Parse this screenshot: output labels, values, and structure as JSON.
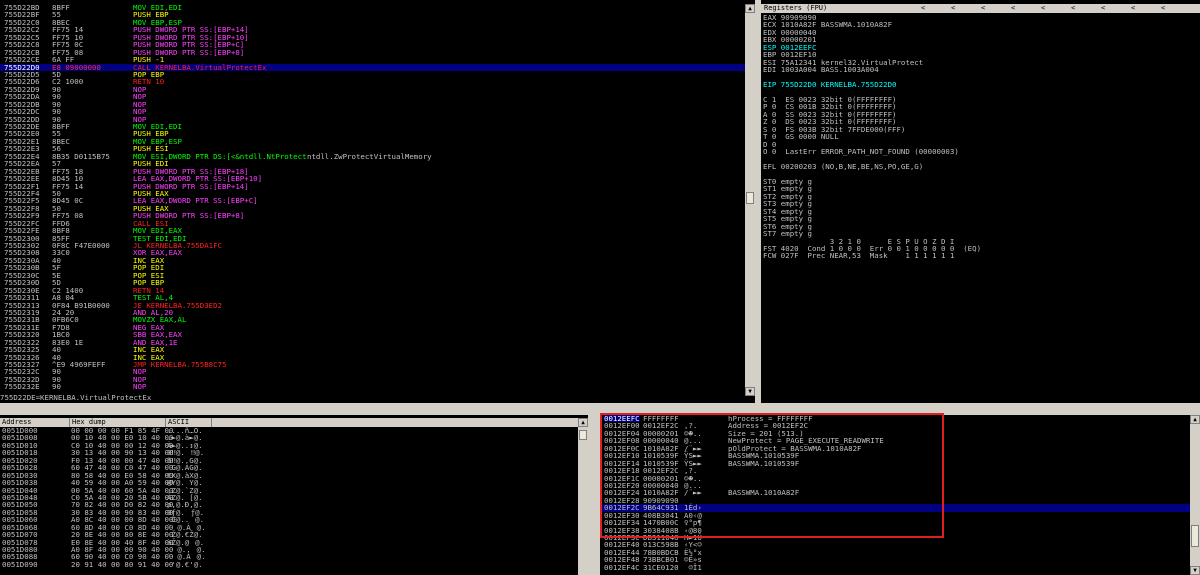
{
  "colors": {
    "mnem_green": "#00ff00",
    "mnem_yellow": "#ffff00",
    "mnem_magenta": "#ff40ff",
    "mnem_red": "#ff2020",
    "mnem_cyan": "#00ffff",
    "mnem_white": "#ffffff",
    "mnem_blue": "#8080ff",
    "selection_bg": "#000080",
    "highlight_box": "#e02020"
  },
  "disasm": [
    {
      "addr": "755D22BD",
      "hex": "8BFF",
      "mnem": "MOV EDI,EDI",
      "c": "mnem_green"
    },
    {
      "addr": "755D22BF",
      "hex": "55",
      "mnem": "PUSH EBP",
      "c": "mnem_yellow"
    },
    {
      "addr": "755D22C0",
      "hex": "8BEC",
      "mnem": "MOV EBP,ESP",
      "c": "mnem_green"
    },
    {
      "addr": "755D22C2",
      "hex": "FF75 14",
      "mnem": "PUSH DWORD PTR SS:[EBP+14]",
      "c": "mnem_magenta"
    },
    {
      "addr": "755D22C5",
      "hex": "FF75 10",
      "mnem": "PUSH DWORD PTR SS:[EBP+10]",
      "c": "mnem_magenta"
    },
    {
      "addr": "755D22C8",
      "hex": "FF75 0C",
      "mnem": "PUSH DWORD PTR SS:[EBP+C]",
      "c": "mnem_magenta"
    },
    {
      "addr": "755D22CB",
      "hex": "FF75 08",
      "mnem": "PUSH DWORD PTR SS:[EBP+8]",
      "c": "mnem_magenta"
    },
    {
      "addr": "755D22CE",
      "hex": "6A FF",
      "mnem": "PUSH -1",
      "c": "mnem_yellow"
    },
    {
      "addr": "755D22D0",
      "hex": "E8 09000000",
      "mnem": "CALL KERNELBA.VirtualProtectEx",
      "c": "mnem_red",
      "sel": true
    },
    {
      "addr": "755D22D5",
      "hex": "5D",
      "mnem": "POP EBP",
      "c": "mnem_yellow"
    },
    {
      "addr": "755D22D6",
      "hex": "C2 1000",
      "mnem": "RETN 10",
      "c": "mnem_red"
    },
    {
      "addr": "755D22D9",
      "hex": "90",
      "mnem": "NOP",
      "c": "mnem_magenta"
    },
    {
      "addr": "755D22DA",
      "hex": "90",
      "mnem": "NOP",
      "c": "mnem_magenta"
    },
    {
      "addr": "755D22DB",
      "hex": "90",
      "mnem": "NOP",
      "c": "mnem_magenta"
    },
    {
      "addr": "755D22DC",
      "hex": "90",
      "mnem": "NOP",
      "c": "mnem_magenta"
    },
    {
      "addr": "755D22DD",
      "hex": "90",
      "mnem": "NOP",
      "c": "mnem_magenta"
    },
    {
      "addr": "755D22DE",
      "hex": "8BFF",
      "mnem": "MOV EDI,EDI",
      "c": "mnem_green"
    },
    {
      "addr": "755D22E0",
      "hex": "55",
      "mnem": "PUSH EBP",
      "c": "mnem_yellow"
    },
    {
      "addr": "755D22E1",
      "hex": "8BEC",
      "mnem": "MOV EBP,ESP",
      "c": "mnem_green"
    },
    {
      "addr": "755D22E3",
      "hex": "56",
      "mnem": "PUSH ESI",
      "c": "mnem_yellow"
    },
    {
      "addr": "755D22E4",
      "hex": "8B35 D0115B75",
      "mnem": "MOV ESI,DWORD PTR DS:[<&ntdll.NtProtect",
      "c": "mnem_green",
      "extra": "ntdll.ZwProtectVirtualMemory"
    },
    {
      "addr": "755D22EA",
      "hex": "57",
      "mnem": "PUSH EDI",
      "c": "mnem_yellow"
    },
    {
      "addr": "755D22EB",
      "hex": "FF75 18",
      "mnem": "PUSH DWORD PTR SS:[EBP+18]",
      "c": "mnem_magenta"
    },
    {
      "addr": "755D22EE",
      "hex": "8D45 10",
      "mnem": "LEA EAX,DWORD PTR SS:[EBP+10]",
      "c": "mnem_magenta"
    },
    {
      "addr": "755D22F1",
      "hex": "FF75 14",
      "mnem": "PUSH DWORD PTR SS:[EBP+14]",
      "c": "mnem_magenta"
    },
    {
      "addr": "755D22F4",
      "hex": "50",
      "mnem": "PUSH EAX",
      "c": "mnem_yellow"
    },
    {
      "addr": "755D22F5",
      "hex": "8D45 0C",
      "mnem": "LEA EAX,DWORD PTR SS:[EBP+C]",
      "c": "mnem_magenta"
    },
    {
      "addr": "755D22F8",
      "hex": "50",
      "mnem": "PUSH EAX",
      "c": "mnem_yellow"
    },
    {
      "addr": "755D22F9",
      "hex": "FF75 08",
      "mnem": "PUSH DWORD PTR SS:[EBP+8]",
      "c": "mnem_magenta"
    },
    {
      "addr": "755D22FC",
      "hex": "FFD6",
      "mnem": "CALL ESI",
      "c": "mnem_red"
    },
    {
      "addr": "755D22FE",
      "hex": "8BF8",
      "mnem": "MOV EDI,EAX",
      "c": "mnem_green"
    },
    {
      "addr": "755D2300",
      "hex": "85FF",
      "mnem": "TEST EDI,EDI",
      "c": "mnem_green"
    },
    {
      "addr": "755D2302",
      "hex": "0F8C F47E0000",
      "mnem": "JL KERNELBA.755DA1FC",
      "c": "mnem_red"
    },
    {
      "addr": "755D2308",
      "hex": "33C0",
      "mnem": "XOR EAX,EAX",
      "c": "mnem_magenta"
    },
    {
      "addr": "755D230A",
      "hex": "40",
      "mnem": "INC EAX",
      "c": "mnem_yellow"
    },
    {
      "addr": "755D230B",
      "hex": "5F",
      "mnem": "POP EDI",
      "c": "mnem_yellow"
    },
    {
      "addr": "755D230C",
      "hex": "5E",
      "mnem": "POP ESI",
      "c": "mnem_yellow"
    },
    {
      "addr": "755D230D",
      "hex": "5D",
      "mnem": "POP EBP",
      "c": "mnem_yellow"
    },
    {
      "addr": "755D230E",
      "hex": "C2 1400",
      "mnem": "RETN 14",
      "c": "mnem_red"
    },
    {
      "addr": "755D2311",
      "hex": "A8 04",
      "mnem": "TEST AL,4",
      "c": "mnem_green"
    },
    {
      "addr": "755D2313",
      "hex": "0F84 B91B0000",
      "mnem": "JE KERNELBA.755D3ED2",
      "c": "mnem_red"
    },
    {
      "addr": "755D2319",
      "hex": "24 20",
      "mnem": "AND AL,20",
      "c": "mnem_magenta"
    },
    {
      "addr": "755D231B",
      "hex": "0FB6C0",
      "mnem": "MOVZX EAX,AL",
      "c": "mnem_green"
    },
    {
      "addr": "755D231E",
      "hex": "F7D8",
      "mnem": "NEG EAX",
      "c": "mnem_magenta"
    },
    {
      "addr": "755D2320",
      "hex": "1BC0",
      "mnem": "SBB EAX,EAX",
      "c": "mnem_magenta"
    },
    {
      "addr": "755D2322",
      "hex": "83E0 1E",
      "mnem": "AND EAX,1E",
      "c": "mnem_magenta"
    },
    {
      "addr": "755D2325",
      "hex": "40",
      "mnem": "INC EAX",
      "c": "mnem_yellow"
    },
    {
      "addr": "755D2326",
      "hex": "40",
      "mnem": "INC EAX",
      "c": "mnem_yellow"
    },
    {
      "addr": "755D2327",
      "hex": "^E9 4969FEFF",
      "mnem": "JMP KERNELBA.755B8C75",
      "c": "mnem_red"
    },
    {
      "addr": "755D232C",
      "hex": "90",
      "mnem": "NOP",
      "c": "mnem_magenta"
    },
    {
      "addr": "755D232D",
      "hex": "90",
      "mnem": "NOP",
      "c": "mnem_magenta"
    },
    {
      "addr": "755D232E",
      "hex": "90",
      "mnem": "NOP",
      "c": "mnem_magenta"
    }
  ],
  "info_line": "755D22DE=KERNELBA.VirtualProtectEx",
  "registers": {
    "title": "Registers (FPU)",
    "chevrons": [
      "<",
      "<",
      "<",
      "<",
      "<",
      "<",
      "<",
      "<",
      "<"
    ],
    "lines": [
      {
        "t": "EAX 90909090"
      },
      {
        "t": "ECX 1010A82F BASSWMA.1010A82F"
      },
      {
        "t": "EDX 00000040"
      },
      {
        "t": "EBX 00000201"
      },
      {
        "t": "ESP 0012EEFC",
        "hl": true
      },
      {
        "t": "EBP 0012EF10"
      },
      {
        "t": "ESI 75A12341 kernel32.VirtualProtect"
      },
      {
        "t": "EDI 1003A004 BASS.1003A004"
      },
      {
        "t": ""
      },
      {
        "t": "EIP 755D22D0 KERNELBA.755D22D0",
        "hl": true
      },
      {
        "t": ""
      },
      {
        "t": "C 1  ES 0023 32bit 0(FFFFFFFF)"
      },
      {
        "t": "P 0  CS 001B 32bit 0(FFFFFFFF)"
      },
      {
        "t": "A 0  SS 0023 32bit 0(FFFFFFFF)"
      },
      {
        "t": "Z 0  DS 0023 32bit 0(FFFFFFFF)"
      },
      {
        "t": "S 0  FS 003B 32bit 7FFDE000(FFF)"
      },
      {
        "t": "T 0  GS 0000 NULL"
      },
      {
        "t": "D 0"
      },
      {
        "t": "O 0  LastErr ERROR_PATH_NOT_FOUND (00000003)"
      },
      {
        "t": ""
      },
      {
        "t": "EFL 00200203 (NO,B,NE,BE,NS,PO,GE,G)"
      },
      {
        "t": ""
      },
      {
        "t": "ST0 empty g"
      },
      {
        "t": "ST1 empty g"
      },
      {
        "t": "ST2 empty g"
      },
      {
        "t": "ST3 empty g"
      },
      {
        "t": "ST4 empty g"
      },
      {
        "t": "ST5 empty g"
      },
      {
        "t": "ST6 empty g"
      },
      {
        "t": "ST7 empty g"
      },
      {
        "t": "               3 2 1 0      E S P U O Z D I"
      },
      {
        "t": "FST 4020  Cond 1 0 0 0  Err 0 0 1 0 0 0 0 0  (EQ)"
      },
      {
        "t": "FCW 027F  Prec NEAR,53  Mask    1 1 1 1 1 1"
      }
    ]
  },
  "dump": {
    "headers": [
      "Address",
      "Hex dump",
      "ASCII"
    ],
    "rows": [
      {
        "addr": "0051D000",
        "hex": "00 00 00 00 F1 85 4F 00",
        "ascii": "....ñ…O."
      },
      {
        "addr": "0051D008",
        "hex": "00 10 40 00 E0 10 40 00",
        "ascii": ".►@.à►@."
      },
      {
        "addr": "0051D010",
        "hex": "C0 10 40 00 00 12 40 00",
        "ascii": "À►@..↕@."
      },
      {
        "addr": "0051D018",
        "hex": "30 13 40 00 90 13 40 00",
        "ascii": "0‼@.‼@."
      },
      {
        "addr": "0051D020",
        "hex": "F0 13 40 00 00 47 40 00",
        "ascii": "ð‼@..G@."
      },
      {
        "addr": "0051D028",
        "hex": "60 47 40 00 C0 47 40 00",
        "ascii": "`G@.ÀG@."
      },
      {
        "addr": "0051D030",
        "hex": "80 58 40 00 E0 58 40 00",
        "ascii": "€X@.àX@."
      },
      {
        "addr": "0051D038",
        "hex": "40 59 40 00 A0 59 40 00",
        "ascii": "@Y@. Y@."
      },
      {
        "addr": "0051D040",
        "hex": "00 5A 40 00 60 5A 40 00",
        "ascii": ".Z@.`Z@."
      },
      {
        "addr": "0051D048",
        "hex": "C0 5A 40 00 20 5B 40 00",
        "ascii": "ÀZ@. [@."
      },
      {
        "addr": "0051D050",
        "hex": "70 82 40 00 D0 82 40 00",
        "ascii": "p‚@.Ð‚@."
      },
      {
        "addr": "0051D058",
        "hex": "30 83 40 00 90 83 40 00",
        "ascii": "0ƒ@.ƒ@."
      },
      {
        "addr": "0051D060",
        "hex": "A0 8C 40 00 00 8D 40 00",
        "ascii": " Œ@..@."
      },
      {
        "addr": "0051D068",
        "hex": "60 8D 40 00 C0 8D 40 00",
        "ascii": "`@.À@."
      },
      {
        "addr": "0051D070",
        "hex": "20 8E 40 00 80 8E 40 00",
        "ascii": " Ž@.€Ž@."
      },
      {
        "addr": "0051D078",
        "hex": "E0 8E 40 00 40 8F 40 00",
        "ascii": "àŽ@.@@."
      },
      {
        "addr": "0051D080",
        "hex": "A0 8F 40 00 00 90 40 00",
        "ascii": " @..@."
      },
      {
        "addr": "0051D088",
        "hex": "60 90 40 00 C0 90 40 00",
        "ascii": "`@.À@."
      },
      {
        "addr": "0051D090",
        "hex": "20 91 40 00 80 91 40 00",
        "ascii": " '@.€'@."
      }
    ]
  },
  "stack": {
    "rows": [
      {
        "addr": "0012EEFC",
        "val": "FFFFFFFF",
        "asc": "",
        "cmt": "hProcess = FFFFFFFF",
        "sel": true,
        "addrhl": true
      },
      {
        "addr": "0012EF00",
        "val": "0012EF2C",
        "asc": ",?.",
        "cmt": "Address = 0012EF2C"
      },
      {
        "addr": "0012EF04",
        "val": "00000201",
        "asc": "☺☻..",
        "cmt": "Size = 201 (513.)"
      },
      {
        "addr": "0012EF08",
        "val": "00000040",
        "asc": "@...",
        "cmt": "NewProtect = PAGE_EXECUTE_READWRITE"
      },
      {
        "addr": "0012EF0C",
        "val": "1010A82F",
        "asc": "/¨►►",
        "cmt": "pOldProtect = BASSWMA.1010A82F"
      },
      {
        "addr": "0012EF10",
        "val": "1010539F",
        "asc": "ŸS►►",
        "cmt": "BASSWMA.1010539F"
      },
      {
        "addr": "0012EF14",
        "val": "1010539F",
        "asc": "ŸS►►",
        "cmt": "BASSWMA.1010539F"
      },
      {
        "addr": "0012EF18",
        "val": "0012EF2C",
        "asc": ",?.",
        "cmt": ""
      },
      {
        "addr": "0012EF1C",
        "val": "00000201",
        "asc": "☺☻..",
        "cmt": ""
      },
      {
        "addr": "0012EF20",
        "val": "00000040",
        "asc": "@...",
        "cmt": ""
      },
      {
        "addr": "0012EF24",
        "val": "1010A82F",
        "asc": "/¨►►",
        "cmt": "BASSWMA.1010A82F"
      },
      {
        "addr": "0012EF28",
        "val": "90909090",
        "asc": "",
        "cmt": ""
      },
      {
        "addr": "0012EF2C",
        "val": "9B64C931",
        "asc": "1Éd›",
        "cmt": "",
        "hl": true
      },
      {
        "addr": "0012EF30",
        "val": "408B3041",
        "asc": "A0‹@",
        "cmt": ""
      },
      {
        "addr": "0012EF34",
        "val": "1470B00C",
        "asc": "♀°p¶",
        "cmt": ""
      },
      {
        "addr": "0012EF38",
        "val": "3038408B",
        "asc": "‹@80",
        "cmt": ""
      },
      {
        "addr": "0012EF3C",
        "val": "DB311048",
        "asc": "H►1Û",
        "cmt": ""
      },
      {
        "addr": "0012EF40",
        "val": "013C598B",
        "asc": "‹Y<☺",
        "cmt": ""
      },
      {
        "addr": "0012EF44",
        "val": "78B0BDCB",
        "asc": "Ë½°x",
        "cmt": ""
      },
      {
        "addr": "0012EF48",
        "val": "73BBCB01",
        "asc": "☺Ë»s",
        "cmt": ""
      },
      {
        "addr": "0012EF4C",
        "val": "31CE0120",
        "asc": " ☺Î1",
        "cmt": ""
      }
    ]
  }
}
